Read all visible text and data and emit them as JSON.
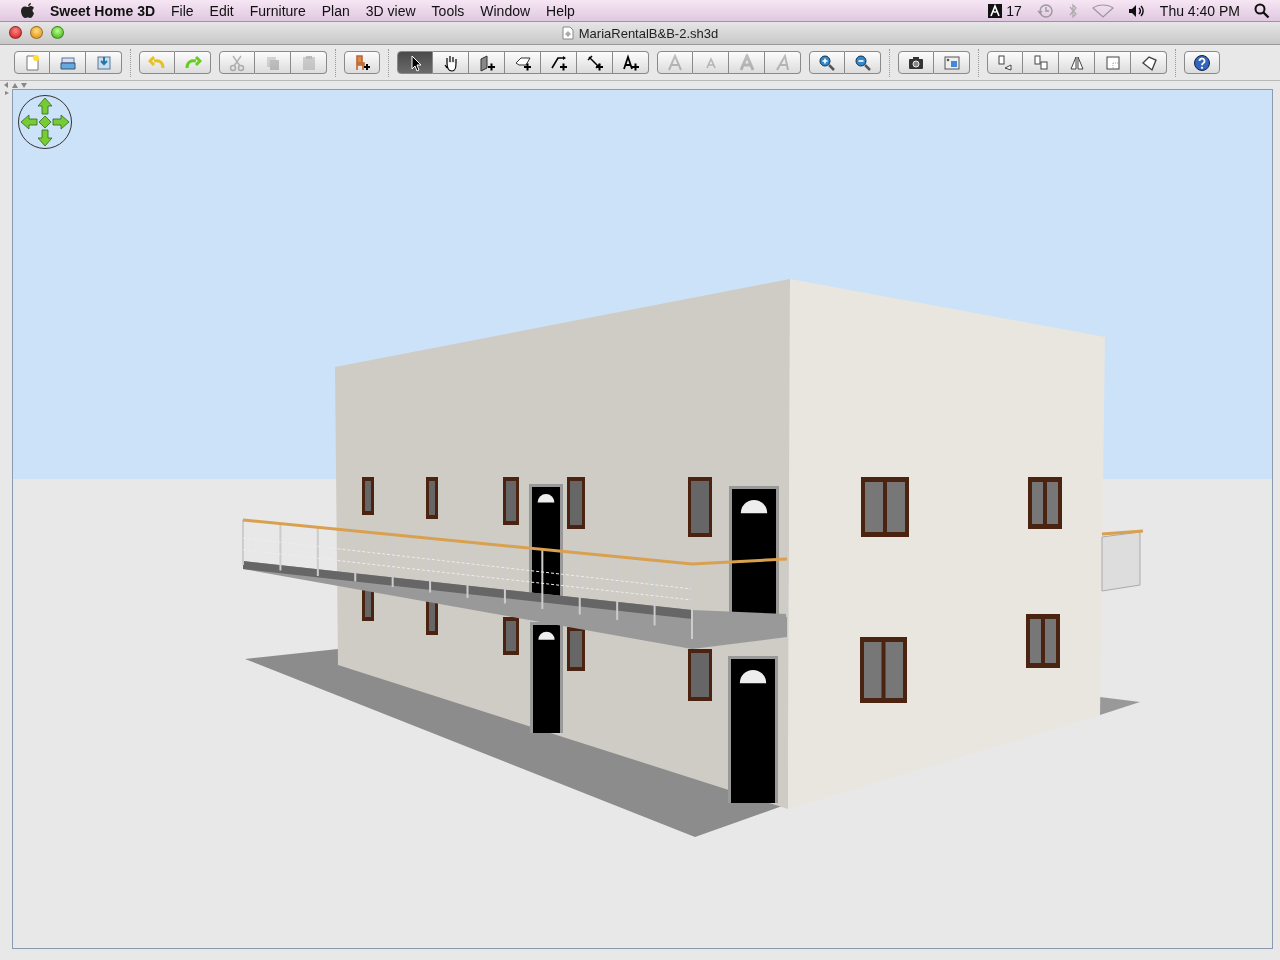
{
  "menu_bar": {
    "app_name": "Sweet Home 3D",
    "menus": [
      "File",
      "Edit",
      "Furniture",
      "Plan",
      "3D view",
      "Tools",
      "Window",
      "Help"
    ],
    "adobe_count": "17",
    "clock": "Thu 4:40 PM"
  },
  "window": {
    "title": "MariaRentalB&B-2.sh3d"
  },
  "toolbar": {
    "groups": [
      {
        "divider": false,
        "buttons": [
          {
            "kind": "new",
            "disabled": false
          },
          {
            "kind": "open",
            "disabled": false
          },
          {
            "kind": "save",
            "disabled": false
          }
        ]
      },
      {
        "divider": true,
        "buttons": [
          {
            "kind": "undo",
            "disabled": false
          },
          {
            "kind": "redo",
            "disabled": false
          }
        ]
      },
      {
        "divider": false,
        "buttons": [
          {
            "kind": "cut",
            "disabled": true
          },
          {
            "kind": "copy",
            "disabled": true
          },
          {
            "kind": "paste",
            "disabled": true
          }
        ]
      },
      {
        "divider": true,
        "buttons": [
          {
            "kind": "furniture",
            "disabled": false
          }
        ]
      },
      {
        "divider": true,
        "buttons": [
          {
            "kind": "select",
            "disabled": false,
            "selected": true
          },
          {
            "kind": "pan",
            "disabled": false,
            "selected": false
          },
          {
            "kind": "wall",
            "disabled": false,
            "selected": false
          },
          {
            "kind": "room",
            "disabled": false,
            "selected": false
          },
          {
            "kind": "polyline",
            "disabled": false,
            "selected": false
          },
          {
            "kind": "dimension",
            "disabled": false,
            "selected": false
          },
          {
            "kind": "text",
            "disabled": false,
            "selected": false
          }
        ]
      },
      {
        "divider": false,
        "buttons": [
          {
            "kind": "enlarge",
            "disabled": true
          },
          {
            "kind": "shrink",
            "disabled": true
          },
          {
            "kind": "bold",
            "disabled": true
          },
          {
            "kind": "italic",
            "disabled": true
          }
        ]
      },
      {
        "divider": false,
        "buttons": [
          {
            "kind": "zoomin",
            "disabled": false
          },
          {
            "kind": "zoomout",
            "disabled": false
          }
        ]
      },
      {
        "divider": true,
        "buttons": [
          {
            "kind": "photo",
            "disabled": false
          },
          {
            "kind": "video",
            "disabled": false
          }
        ]
      },
      {
        "divider": true,
        "buttons": [
          {
            "kind": "swap",
            "disabled": false
          },
          {
            "kind": "align",
            "disabled": false
          },
          {
            "kind": "mirror",
            "disabled": false
          },
          {
            "kind": "square",
            "disabled": false
          },
          {
            "kind": "outline",
            "disabled": false
          }
        ]
      },
      {
        "divider": true,
        "buttons": [
          {
            "kind": "help",
            "disabled": false
          }
        ]
      }
    ]
  }
}
